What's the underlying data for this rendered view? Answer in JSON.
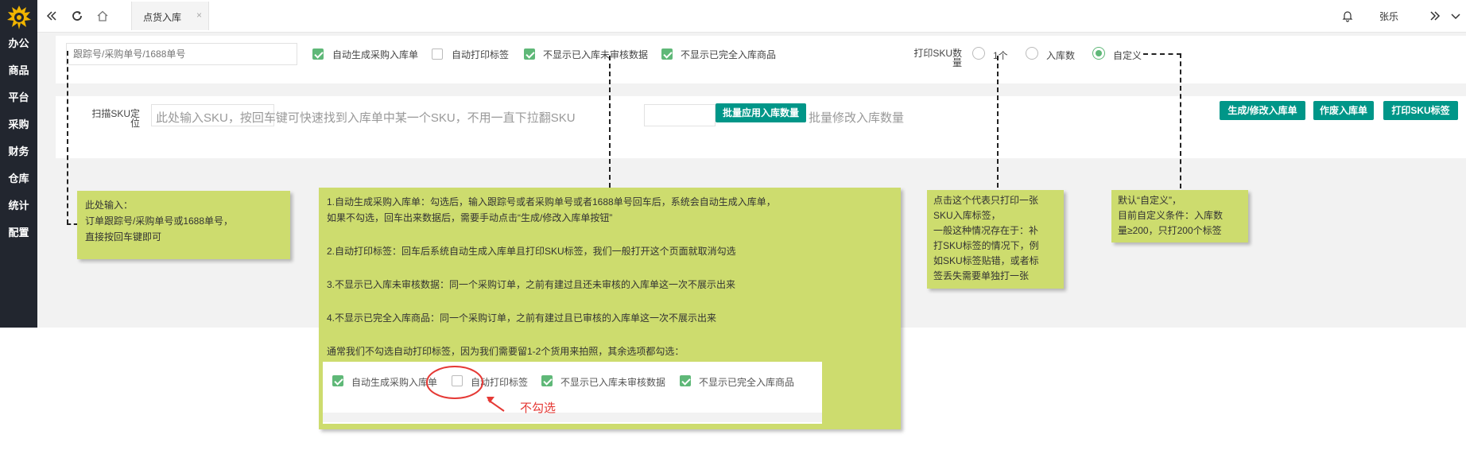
{
  "sidebar": {
    "items": [
      "办公",
      "商品",
      "平台",
      "采购",
      "财务",
      "仓库",
      "统计",
      "配置"
    ]
  },
  "topbar": {
    "tab_label": "点货入库",
    "tab_close": "×",
    "user_name": "张乐"
  },
  "filters": {
    "tracking_placeholder": "跟踪号/采购单号/1688单号",
    "options": [
      {
        "label": "自动生成采购入库单",
        "checked": true
      },
      {
        "label": "自动打印标签",
        "checked": false
      },
      {
        "label": "不显示已入库未审核数据",
        "checked": true
      },
      {
        "label": "不显示已完全入库商品",
        "checked": true
      }
    ],
    "print_sku_label": "打印SKU数量",
    "print_options": [
      {
        "label": "1个",
        "selected": false
      },
      {
        "label": "入库数",
        "selected": false
      },
      {
        "label": "自定义",
        "selected": true
      }
    ]
  },
  "scan": {
    "label": "扫描SKU定位",
    "placeholder": "此处输入SKU，按回车键可快速找到入库单中某一个SKU，不用一直下拉翻SKU",
    "batch_button": "批量应用入库数量",
    "batch_hint": "批量修改入库数量",
    "buttons": [
      "生成/修改入库单",
      "作废入库单",
      "打印SKU标签"
    ]
  },
  "notes": {
    "input_tip": [
      "此处输入：",
      "订单跟踪号/采购单号或1688单号，",
      "直接按回车键即可"
    ],
    "options_tip": [
      "1.自动生成采购入库单：勾选后，输入跟踪号或者采购单号或者1688单号回车后，系统会自动生成入库单，",
      "如果不勾选，回车出来数据后，需要手动点击“生成/修改入库单按钮”",
      "2.自动打印标签：回车后系统自动生成入库单且打印SKU标签，我们一般打开这个页面就取消勾选",
      "3.不显示已入库未审核数据：同一个采购订单，之前有建过且还未审核的入库单这一次不展示出来",
      "4.不显示已完全入库商品：同一个采购订单，之前有建过且已审核的入库单这一次不展示出来",
      "通常我们不勾选自动打印标签，因为我们需要留1-2个货用来拍照，其余选项都勾选："
    ],
    "one_tip": [
      "点击这个代表只打印一张",
      "SKU入库标签，",
      "一般这种情况存在于：补",
      "打SKU标签的情况下，例",
      "如SKU标签贴错，或者标",
      "签丢失需要单独打一张"
    ],
    "custom_tip": [
      "默认“自定义”，",
      "目前自定义条件：入库数",
      "量≥200，只打200个标签"
    ],
    "example_options": [
      {
        "label": "自动生成采购入库单",
        "checked": true
      },
      {
        "label": "自动打印标签",
        "checked": false
      },
      {
        "label": "不显示已入库未审核数据",
        "checked": true
      },
      {
        "label": "不显示已完全入库商品",
        "checked": true
      }
    ],
    "no_check_label": "不勾选"
  },
  "colors": {
    "sidebar": "#22262f",
    "accent": "#009688",
    "check": "#5fb878",
    "note": "#cddc6e",
    "annotation": "#e53935"
  }
}
